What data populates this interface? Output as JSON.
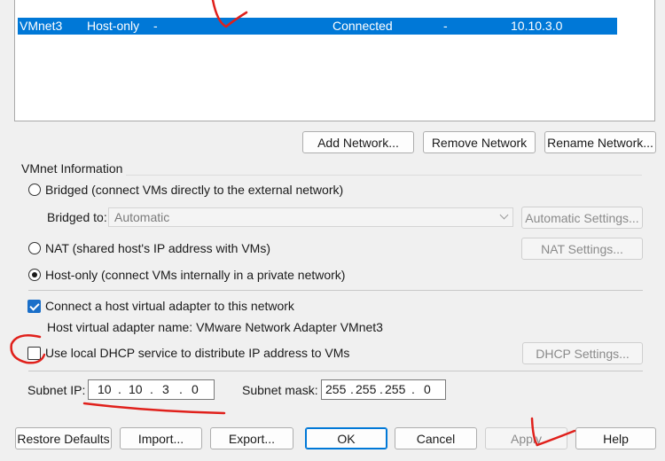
{
  "network_list": {
    "selected_row": {
      "name": "VMnet3",
      "type": "Host-only",
      "external": "-",
      "host_connection": "Connected",
      "dhcp": "-",
      "subnet": "10.10.3.0"
    }
  },
  "network_buttons": {
    "add": "Add Network...",
    "remove": "Remove Network",
    "rename": "Rename Network..."
  },
  "vmnet_info": {
    "group_title": "VMnet Information",
    "bridged_label": "Bridged (connect VMs directly to the external network)",
    "bridged_to_label": "Bridged to:",
    "bridged_to_value": "Automatic",
    "automatic_settings": "Automatic Settings...",
    "nat_label": "NAT (shared host's IP address with VMs)",
    "nat_settings": "NAT Settings...",
    "hostonly_label": "Host-only (connect VMs internally in a private network)",
    "connect_adapter_label": "Connect a host virtual adapter to this network",
    "adapter_name_text": "Host virtual adapter name: VMware Network Adapter VMnet3",
    "dhcp_label": "Use local DHCP service to distribute IP address to VMs",
    "dhcp_settings": "DHCP Settings...",
    "subnet_ip_label": "Subnet IP:",
    "subnet_ip": [
      "10",
      "10",
      "3",
      "0"
    ],
    "subnet_mask_label": "Subnet mask:",
    "subnet_mask": [
      "255",
      "255",
      "255",
      "0"
    ],
    "ip_dot": "."
  },
  "footer_buttons": {
    "restore": "Restore Defaults",
    "import": "Import...",
    "export": "Export...",
    "ok": "OK",
    "cancel": "Cancel",
    "apply": "Apply",
    "help": "Help"
  },
  "state": {
    "selected_mode": "Host-only",
    "connect_adapter_checked": true,
    "dhcp_checked": false
  },
  "colors": {
    "selection": "#0078d7",
    "annotation": "#e0201b"
  }
}
